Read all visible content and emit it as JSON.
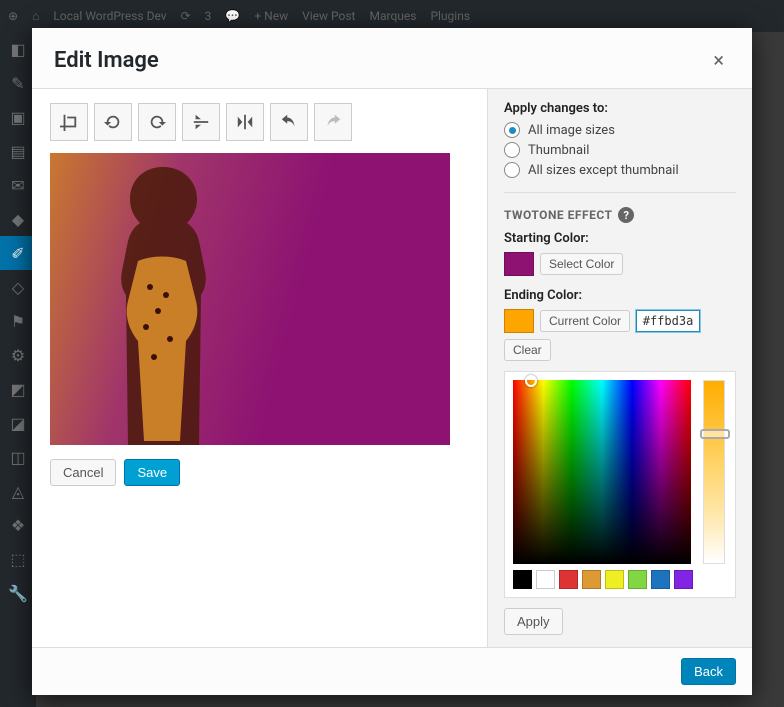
{
  "adminbar": {
    "site": "Local WordPress Dev",
    "updates": "3",
    "comments": "",
    "new": "New",
    "viewpost": "View Post",
    "user": "Marques",
    "plugins": "Plugins"
  },
  "modal": {
    "title": "Edit Image",
    "close": "×"
  },
  "toolbar": {
    "crop": "Crop",
    "rotate_ccw": "Rotate CCW",
    "rotate_cw": "Rotate CW",
    "flip_v": "Flip V",
    "flip_h": "Flip H",
    "undo": "Undo",
    "redo": "Redo"
  },
  "actions": {
    "cancel": "Cancel",
    "save": "Save",
    "back": "Back",
    "apply": "Apply"
  },
  "right": {
    "apply_to_label": "Apply changes to:",
    "options": {
      "all": "All image sizes",
      "thumb": "Thumbnail",
      "except": "All sizes except thumbnail"
    },
    "selected": "all",
    "twotone_title": "TWOTONE EFFECT",
    "help": "?",
    "starting_label": "Starting Color:",
    "starting_swatch": "#8d1272",
    "starting_btn": "Select Color",
    "ending_label": "Ending Color:",
    "ending_swatch": "#ffa500",
    "ending_btn": "Current Color",
    "ending_hex": "#ffbd3a",
    "clear": "Clear"
  },
  "presets": [
    "#000000",
    "#ffffff",
    "#dd3333",
    "#dd9933",
    "#eeee22",
    "#81d742",
    "#1e73be",
    "#8224e3"
  ]
}
